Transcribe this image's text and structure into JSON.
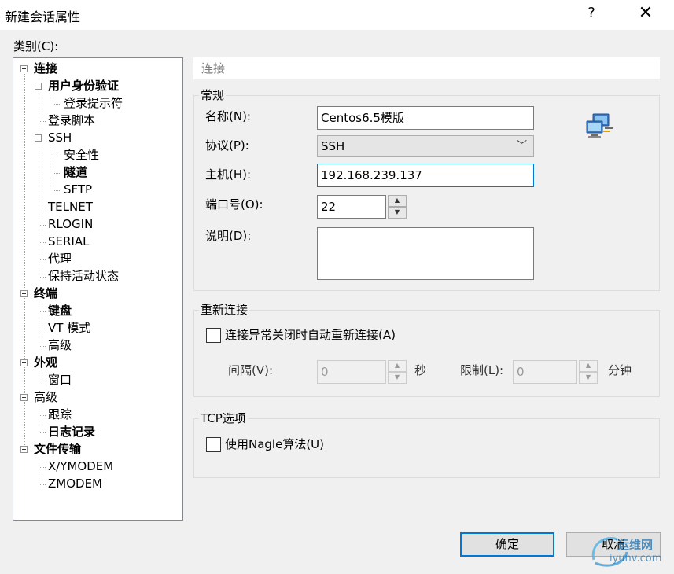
{
  "window": {
    "title": "新建会话属性",
    "help_glyph": "?",
    "close_glyph": "✕"
  },
  "category_label": "类别(C):",
  "tree": [
    {
      "label": "连接",
      "bold": true
    },
    {
      "label": "用户身份验证",
      "bold": true
    },
    {
      "label": "登录提示符",
      "bold": false
    },
    {
      "label": "登录脚本",
      "bold": false
    },
    {
      "label": "SSH",
      "bold": false
    },
    {
      "label": "安全性",
      "bold": false
    },
    {
      "label": "隧道",
      "bold": true
    },
    {
      "label": "SFTP",
      "bold": false
    },
    {
      "label": "TELNET",
      "bold": false
    },
    {
      "label": "RLOGIN",
      "bold": false
    },
    {
      "label": "SERIAL",
      "bold": false
    },
    {
      "label": "代理",
      "bold": false
    },
    {
      "label": "保持活动状态",
      "bold": false
    },
    {
      "label": "终端",
      "bold": true
    },
    {
      "label": "键盘",
      "bold": true
    },
    {
      "label": "VT 模式",
      "bold": false
    },
    {
      "label": "高级",
      "bold": false
    },
    {
      "label": "外观",
      "bold": true
    },
    {
      "label": "窗口",
      "bold": false
    },
    {
      "label": "高级",
      "bold": false
    },
    {
      "label": "跟踪",
      "bold": false
    },
    {
      "label": "日志记录",
      "bold": true
    },
    {
      "label": "文件传输",
      "bold": true
    },
    {
      "label": "X/YMODEM",
      "bold": false
    },
    {
      "label": "ZMODEM",
      "bold": false
    }
  ],
  "section_header": "连接",
  "general": {
    "title": "常规",
    "name_label": "名称(N):",
    "name_value": "Centos6.5模版",
    "protocol_label": "协议(P):",
    "protocol_value": "SSH",
    "host_label": "主机(H):",
    "host_value": "192.168.239.137",
    "port_label": "端口号(O):",
    "port_value": "22",
    "desc_label": "说明(D):",
    "desc_value": ""
  },
  "reconnect": {
    "title": "重新连接",
    "checkbox_label": "连接异常关闭时自动重新连接(A)",
    "interval_label": "间隔(V):",
    "interval_value": "0",
    "interval_unit": "秒",
    "limit_label": "限制(L):",
    "limit_value": "0",
    "limit_unit": "分钟"
  },
  "tcp": {
    "title": "TCP选项",
    "nagle_label": "使用Nagle算法(U)"
  },
  "buttons": {
    "ok": "确定",
    "cancel": "取消"
  },
  "watermark": {
    "line1": "运维网",
    "line2": "iyunv.com"
  },
  "colors": {
    "accent": "#0078d7",
    "window_bg": "#f0f0f0"
  }
}
